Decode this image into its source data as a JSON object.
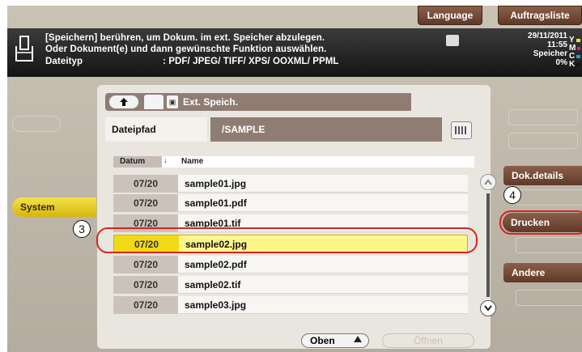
{
  "header": {
    "language_label": "Language",
    "job_list_label": "Auftragsliste"
  },
  "message": {
    "line1": "[Speichern] berühren, um Dokum. im ext. Speicher abzulegen.",
    "line2": "Oder Dokument(e) und dann gewünschte Funktion auswählen.",
    "line3_label": "Dateityp",
    "line3_value": ": PDF/ JPEG/ TIFF/ XPS/ OOXML/ PPML",
    "date": "29/11/2011",
    "time": "11:55",
    "memory_label": "Speicher",
    "memory_value": "0%",
    "toner": [
      {
        "letter": "Y",
        "color": "#f4e21c"
      },
      {
        "letter": "M",
        "color": "#e0168a"
      },
      {
        "letter": "C",
        "color": "#1aa0e6"
      },
      {
        "letter": "K",
        "color": "#111111"
      }
    ]
  },
  "left": {
    "system_label": "System"
  },
  "panel": {
    "location_label": "Ext. Speich.",
    "filepath_label": "Dateipfad",
    "filepath_value": "/SAMPLE",
    "col_date": "Datum",
    "col_sort_glyph": "↓",
    "col_name": "Name",
    "files": [
      {
        "date": "07/20",
        "name": "sample01.jpg",
        "selected": false
      },
      {
        "date": "07/20",
        "name": "sample01.pdf",
        "selected": false
      },
      {
        "date": "07/20",
        "name": "sample01.tif",
        "selected": false
      },
      {
        "date": "07/20",
        "name": "sample02.jpg",
        "selected": true
      },
      {
        "date": "07/20",
        "name": "sample02.pdf",
        "selected": false
      },
      {
        "date": "07/20",
        "name": "sample02.tif",
        "selected": false
      },
      {
        "date": "07/20",
        "name": "sample03.jpg",
        "selected": false
      }
    ],
    "top_label": "Oben",
    "open_label": "Öffnen"
  },
  "right": {
    "doc_details_label": "Dok.details",
    "print_label": "Drucken",
    "other_label": "Andere"
  },
  "callouts": {
    "step3": "3",
    "step4": "4"
  },
  "colors": {
    "accent_brown": "#6e4633",
    "highlight_yellow": "#fff68a",
    "callout_red": "#d8241f"
  }
}
